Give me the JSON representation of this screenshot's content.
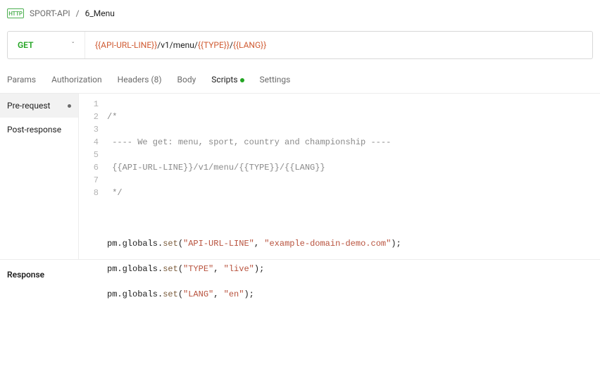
{
  "breadcrumb": {
    "collection": "SPORT-API",
    "item": "6_Menu",
    "separator": "/",
    "http_badge": "HTTP"
  },
  "request": {
    "method": "GET",
    "url_parts": {
      "var1": "{{API-URL-LINE}}",
      "sep1": " /v1/menu/ ",
      "var2": "{{TYPE}}",
      "sep2": " / ",
      "var3": "{{LANG}}"
    }
  },
  "tabs": {
    "params": "Params",
    "authorization": "Authorization",
    "headers": "Headers (8)",
    "body": "Body",
    "scripts": "Scripts",
    "settings": "Settings"
  },
  "scripts_sidebar": {
    "pre_request": "Pre-request",
    "post_response": "Post-response"
  },
  "code": {
    "lines": {
      "l1": "/*",
      "l2": " ---- We get: menu, sport, country and championship ----",
      "l3": " {{API-URL-LINE}}/v1/menu/{{TYPE}}/{{LANG}}",
      "l4": " */",
      "l5": "",
      "l6a": "pm.globals.",
      "l6b": "set",
      "l6c": "(",
      "l6d": "\"API-URL-LINE\"",
      "l6e": ", ",
      "l6f": "\"example-domain-demo.com\"",
      "l6g": ");",
      "l7a": "pm.globals.",
      "l7b": "set",
      "l7c": "(",
      "l7d": "\"TYPE\"",
      "l7e": ", ",
      "l7f": "\"live\"",
      "l7g": ");",
      "l8a": "pm.globals.",
      "l8b": "set",
      "l8c": "(",
      "l8d": "\"LANG\"",
      "l8e": ", ",
      "l8f": "\"en\"",
      "l8g": ");"
    }
  },
  "response": {
    "header": "Response"
  }
}
